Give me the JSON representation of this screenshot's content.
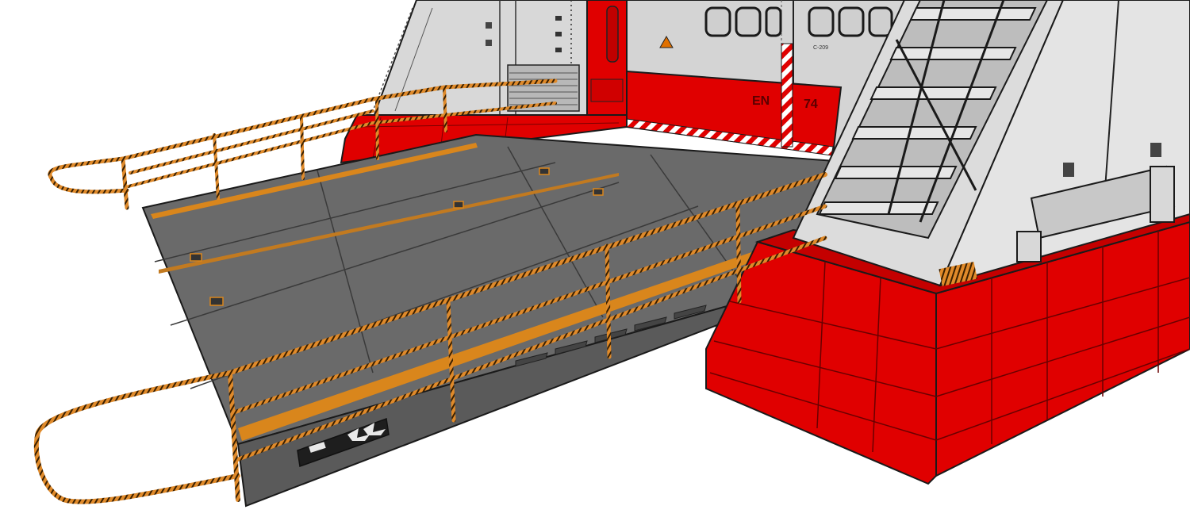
{
  "scene": {
    "hull_markings": {
      "main_code": "EN",
      "number": "74",
      "panel_code": "C-209"
    },
    "colors": {
      "hull_red": "#e00000",
      "hull_red_dark": "#b80000",
      "deck_gray": "#6a6a6a",
      "deck_gray_dark": "#4d4d4d",
      "wall_light": "#dcdcdc",
      "rail_orange": "#e08a2a",
      "stripe_orange": "#d9861c",
      "outline": "#1a1a1a"
    },
    "icons": [
      "chevron-left-icon",
      "chevron-left-icon",
      "arrow-plate-icon"
    ]
  }
}
